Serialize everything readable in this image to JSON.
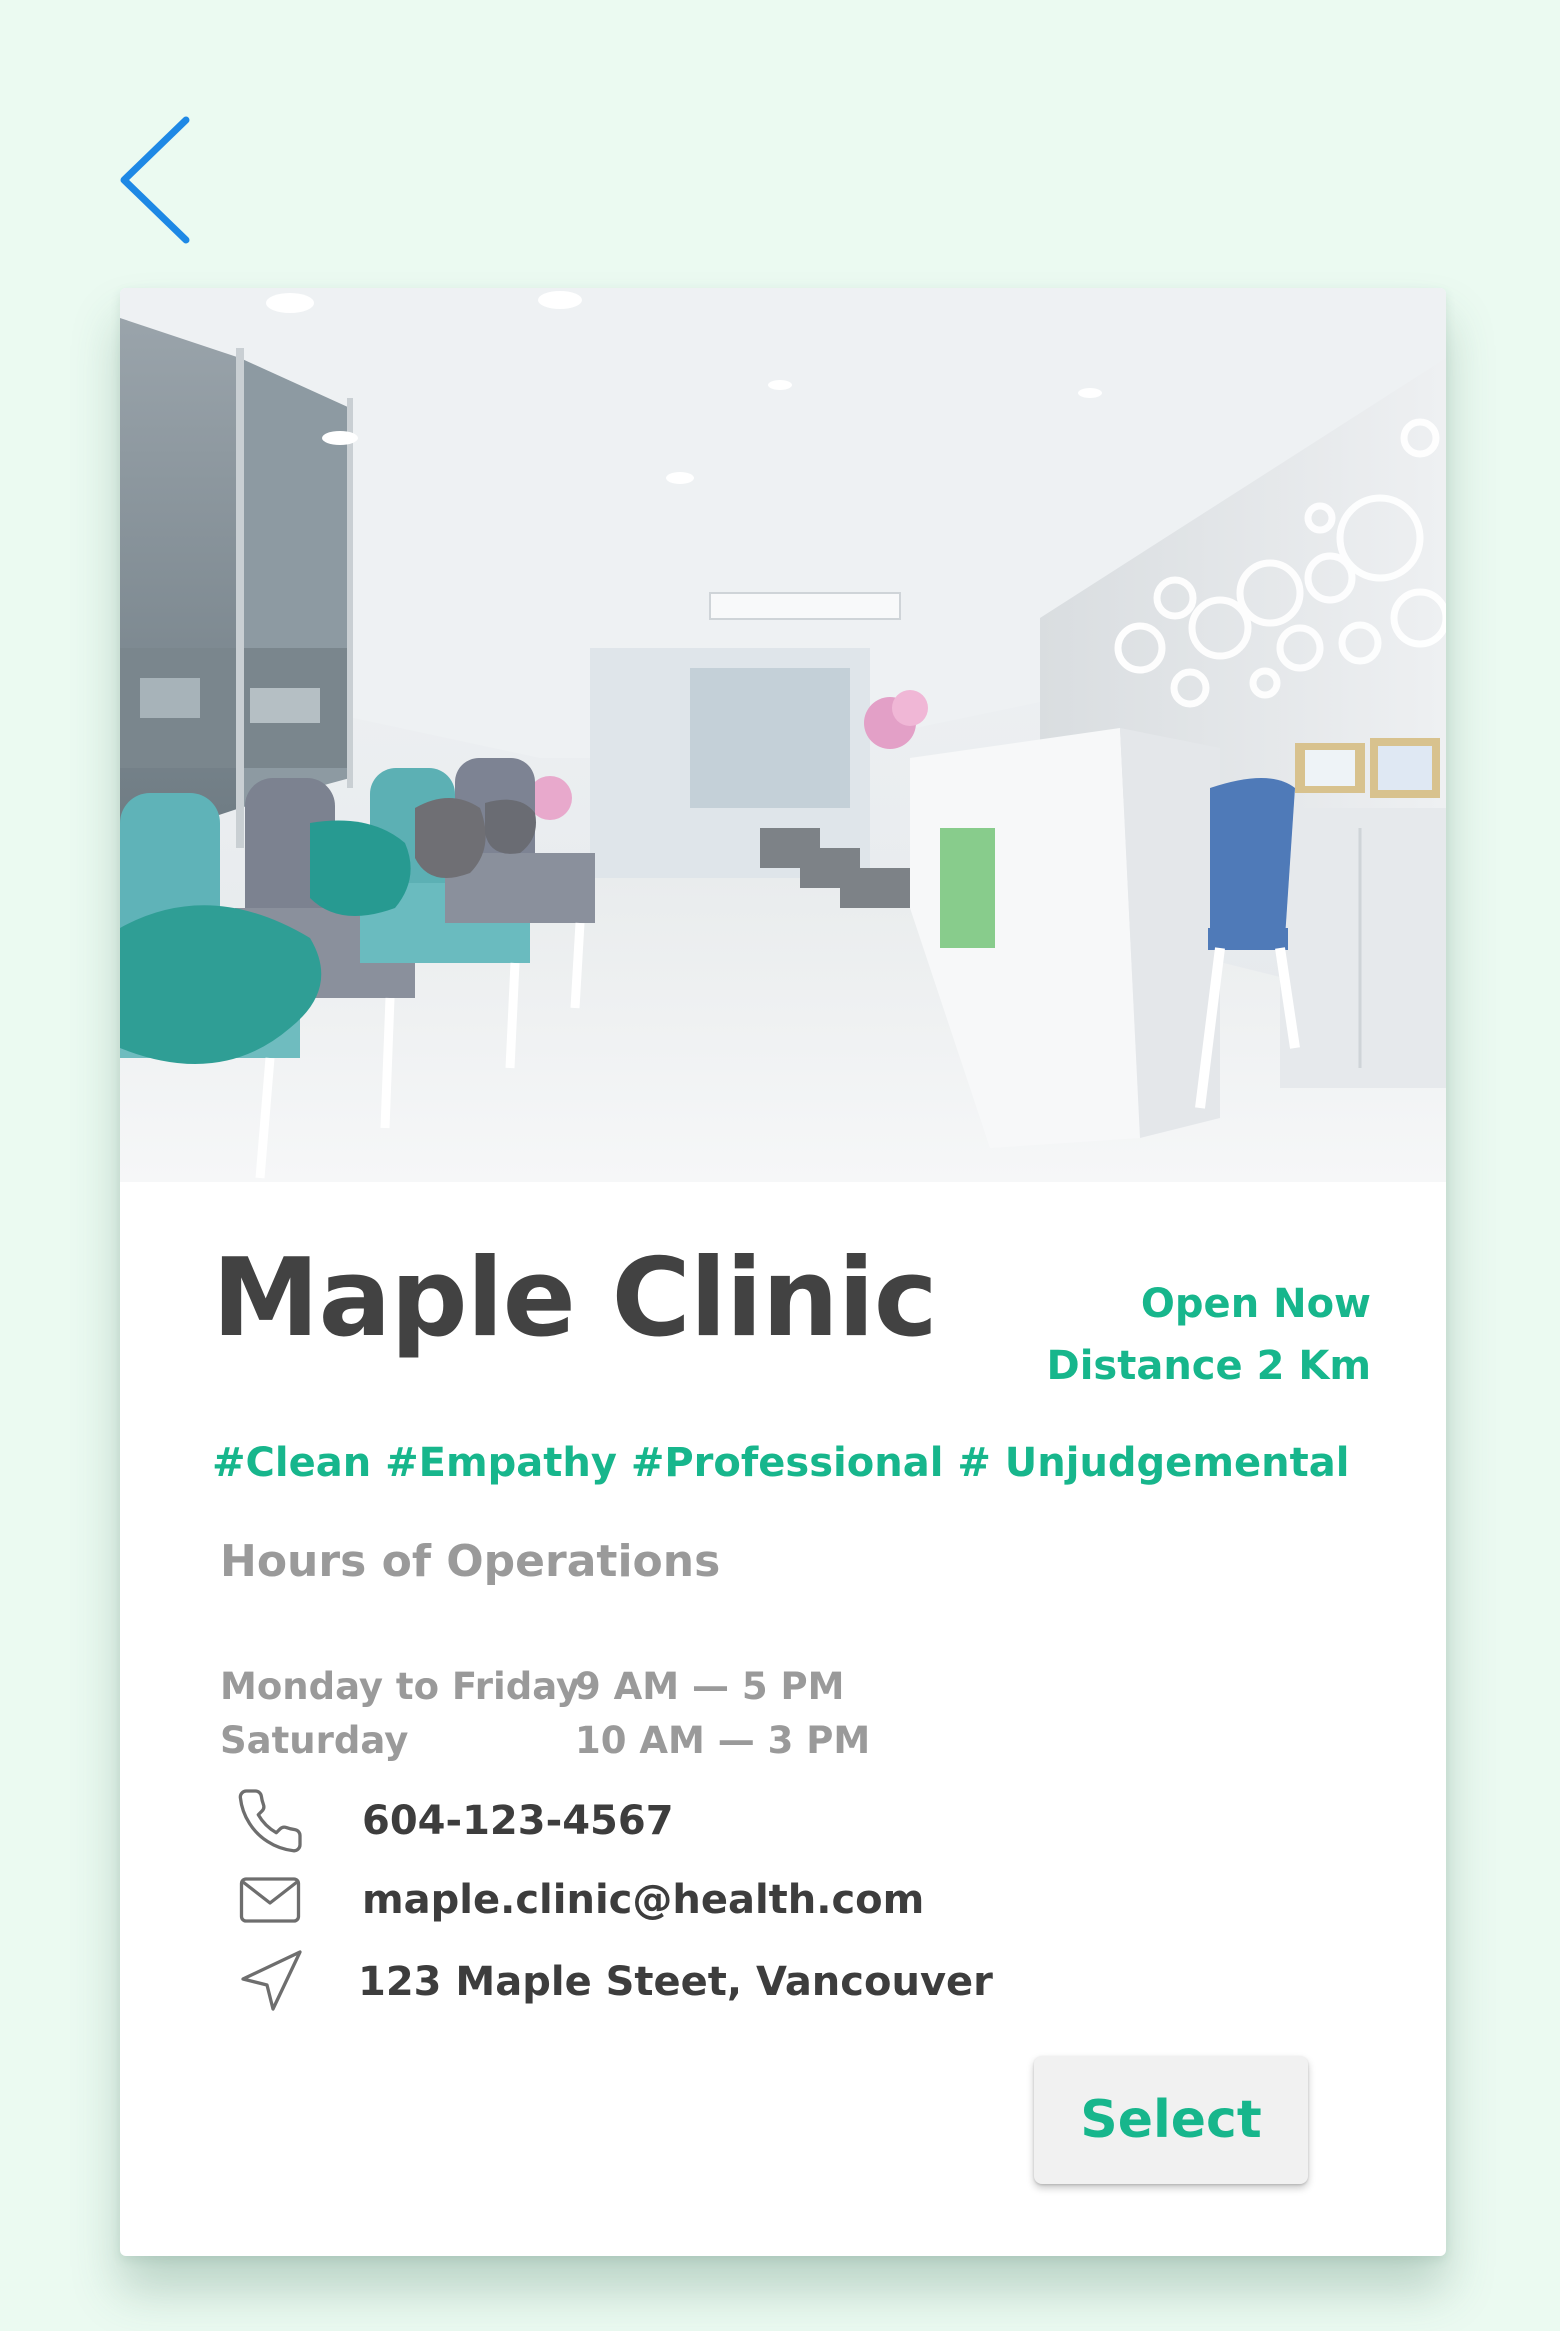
{
  "nav": {
    "back_icon": "chevron-left-icon",
    "accent_color": "#1e88e5"
  },
  "clinic": {
    "name": "Maple Clinic",
    "status": "Open Now",
    "distance": "Distance 2 Km",
    "tags": "#Clean #Empathy #Professional # Unjudgemental",
    "photo": "clinic reception and waiting area photo"
  },
  "hours": {
    "heading": "Hours of Operations",
    "rows": [
      {
        "day": "Monday to Friday",
        "time": "9 AM — 5 PM"
      },
      {
        "day": "Saturday",
        "time": "10 AM — 3 PM"
      }
    ]
  },
  "contact": {
    "phone": "604-123-4567",
    "email": "maple.clinic@health.com",
    "address": "123 Maple Steet, Vancouver",
    "phone_icon": "phone-icon",
    "email_icon": "envelope-icon",
    "address_icon": "navigation-arrow-icon"
  },
  "actions": {
    "select_label": "Select"
  },
  "colors": {
    "background": "#ebfaf1",
    "accent_green": "#17b68c",
    "title_text": "#424242",
    "muted_text": "#9a9a9a"
  }
}
